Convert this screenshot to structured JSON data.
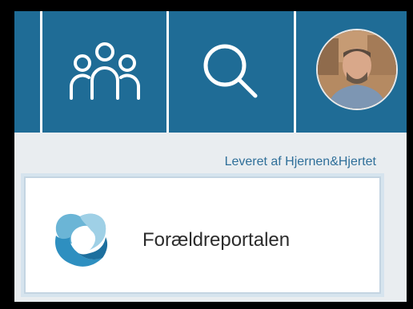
{
  "header": {
    "nav_items": [
      {
        "icon": "users-icon"
      },
      {
        "icon": "search-icon"
      }
    ],
    "avatar": {
      "icon": "user-avatar-photo"
    },
    "background_color": "#1f6c96"
  },
  "credit": {
    "text": "Leveret af Hjernen&Hjertet"
  },
  "portal_card": {
    "label": "Forældreportalen",
    "icon": "foraeldreportal-logo-icon"
  }
}
